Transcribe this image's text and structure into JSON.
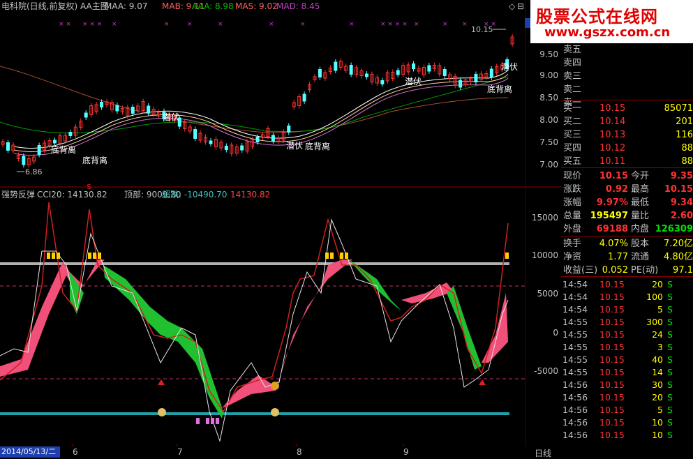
{
  "top_panel": {
    "title": "电科院(日线,前复权) AA主图",
    "maa": "MAA: 9.07",
    "mab": "MAB: 9.11",
    "aaa": "AAA: 8.98",
    "mas": "MAS: 9.02",
    "mad": "MAD: 8.45",
    "high_label": "10.15",
    "low_label": "6.86",
    "price_ticks": [
      "9.50",
      "9.00",
      "8.50",
      "8.00",
      "7.50",
      "7.00"
    ],
    "annotations": {
      "dbl1": "底背离",
      "dbl2": "底背离",
      "qf1": "潜伏",
      "qf2": "潜伏",
      "dbl3": "底背离",
      "qf3": "潜伏",
      "dbl4": "底背离",
      "qf4": "潜伏",
      "dbl5": "底背离"
    }
  },
  "bottom_panel": {
    "title": "强势反弹",
    "cci": "CCI20: 14130.82",
    "top": "顶部: 9009.30",
    "oversold": "超跌: -10490.70",
    "value": "14130.82",
    "ticks": [
      "15000",
      "10000",
      "5000",
      "0",
      "-5000"
    ]
  },
  "status": {
    "date": "2014/05/13/二",
    "period": "日线",
    "months": [
      "6",
      "7",
      "8",
      "9"
    ]
  },
  "watermark": {
    "line1": "股票公式在线网",
    "line2": "www.gszx.com.cn"
  },
  "quote": {
    "sell": [
      {
        "label": "卖五"
      },
      {
        "label": "卖四"
      },
      {
        "label": "卖三"
      },
      {
        "label": "卖二"
      },
      {
        "label": "卖一"
      }
    ],
    "buy": [
      {
        "label": "买一",
        "price": "10.15",
        "vol": "85071"
      },
      {
        "label": "买二",
        "price": "10.14",
        "vol": "201"
      },
      {
        "label": "买三",
        "price": "10.13",
        "vol": "116"
      },
      {
        "label": "买四",
        "price": "10.12",
        "vol": "88"
      },
      {
        "label": "买五",
        "price": "10.11",
        "vol": "88"
      }
    ],
    "stats": {
      "xj_l": "现价",
      "xj": "10.15",
      "jk_l": "今开",
      "jk": "9.35",
      "zd_l": "涨跌",
      "zd": "0.92",
      "zg_l": "最高",
      "zg": "10.15",
      "zf_l": "涨幅",
      "zf": "9.97%",
      "zdi_l": "最低",
      "zdi": "9.34",
      "zl_l": "总量",
      "zl": "195497",
      "lb_l": "量比",
      "lb": "2.60",
      "wp_l": "外盘",
      "wp": "69188",
      "np_l": "内盘",
      "np": "126309",
      "hs_l": "换手",
      "hs": "4.07%",
      "gb_l": "股本",
      "gb": "7.20亿",
      "jz_l": "净资",
      "jz": "1.77",
      "lt_l": "流通",
      "lt": "4.80亿",
      "sy_l": "收益(三)",
      "sy": "0.052",
      "pe_l": "PE(动)",
      "pe": "97.1"
    },
    "ticks": [
      {
        "t": "14:54",
        "p": "10.15",
        "v": "20",
        "s": "S"
      },
      {
        "t": "14:54",
        "p": "10.15",
        "v": "100",
        "s": "S"
      },
      {
        "t": "14:54",
        "p": "10.15",
        "v": "5",
        "s": "S"
      },
      {
        "t": "14:55",
        "p": "10.15",
        "v": "300",
        "s": "S"
      },
      {
        "t": "14:55",
        "p": "10.15",
        "v": "24",
        "s": "S"
      },
      {
        "t": "14:55",
        "p": "10.15",
        "v": "3",
        "s": "S"
      },
      {
        "t": "14:55",
        "p": "10.15",
        "v": "40",
        "s": "S"
      },
      {
        "t": "14:55",
        "p": "10.15",
        "v": "14",
        "s": "S"
      },
      {
        "t": "14:56",
        "p": "10.15",
        "v": "30",
        "s": "S"
      },
      {
        "t": "14:56",
        "p": "10.15",
        "v": "20",
        "s": "S"
      },
      {
        "t": "14:56",
        "p": "10.15",
        "v": "5",
        "s": "S"
      },
      {
        "t": "14:56",
        "p": "10.15",
        "v": "10",
        "s": "S"
      },
      {
        "t": "14:56",
        "p": "10.15",
        "v": "10",
        "s": "S"
      }
    ]
  }
}
